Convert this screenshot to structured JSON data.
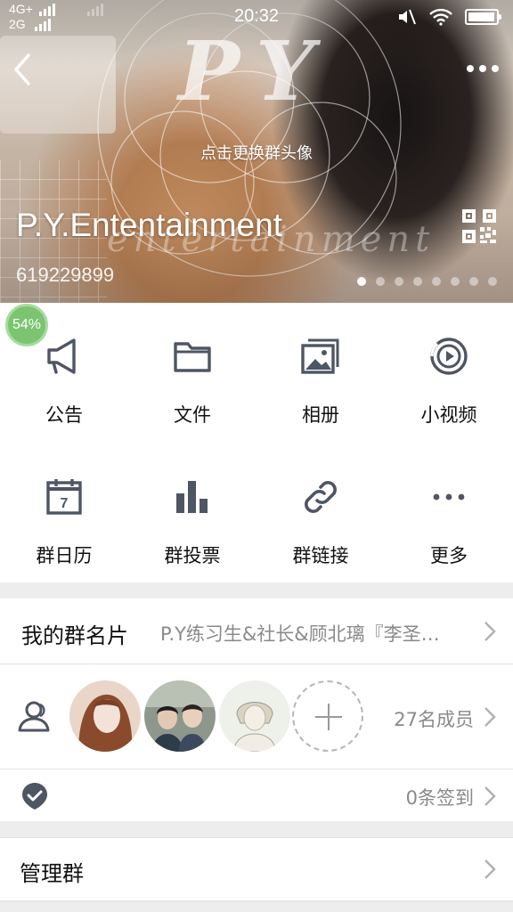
{
  "status_bar": {
    "network_top": "4G+",
    "network_bottom": "2G",
    "time": "20:32",
    "battery_level": 0.95
  },
  "header": {
    "logo_text": "PY",
    "change_avatar_hint": "点击更换群头像",
    "group_name": "P.Y.Ententainment",
    "watermark_text": "entertainment",
    "group_id": "619229899",
    "carousel_pages": 8,
    "carousel_active_index": 0
  },
  "overlay": {
    "progress_text": "54%"
  },
  "features": [
    {
      "label": "公告",
      "icon": "megaphone-icon"
    },
    {
      "label": "文件",
      "icon": "folder-icon"
    },
    {
      "label": "相册",
      "icon": "album-icon"
    },
    {
      "label": "小视频",
      "icon": "video-play-icon"
    },
    {
      "label": "群日历",
      "icon": "calendar-icon",
      "day": "7"
    },
    {
      "label": "群投票",
      "icon": "bar-chart-icon"
    },
    {
      "label": "群链接",
      "icon": "link-icon"
    },
    {
      "label": "更多",
      "icon": "more-dots-icon"
    }
  ],
  "nickname_row": {
    "label": "我的群名片",
    "value": "P.Y练习生&社长&顾北璃『李圣…"
  },
  "members_row": {
    "count_text": "27名成员"
  },
  "signin_row": {
    "count_text": "0条签到"
  },
  "manage_row": {
    "label": "管理群"
  },
  "colors": {
    "icon_gray": "#4e5563",
    "secondary_text": "#8a8a8a",
    "progress_green": "#7cc472"
  }
}
